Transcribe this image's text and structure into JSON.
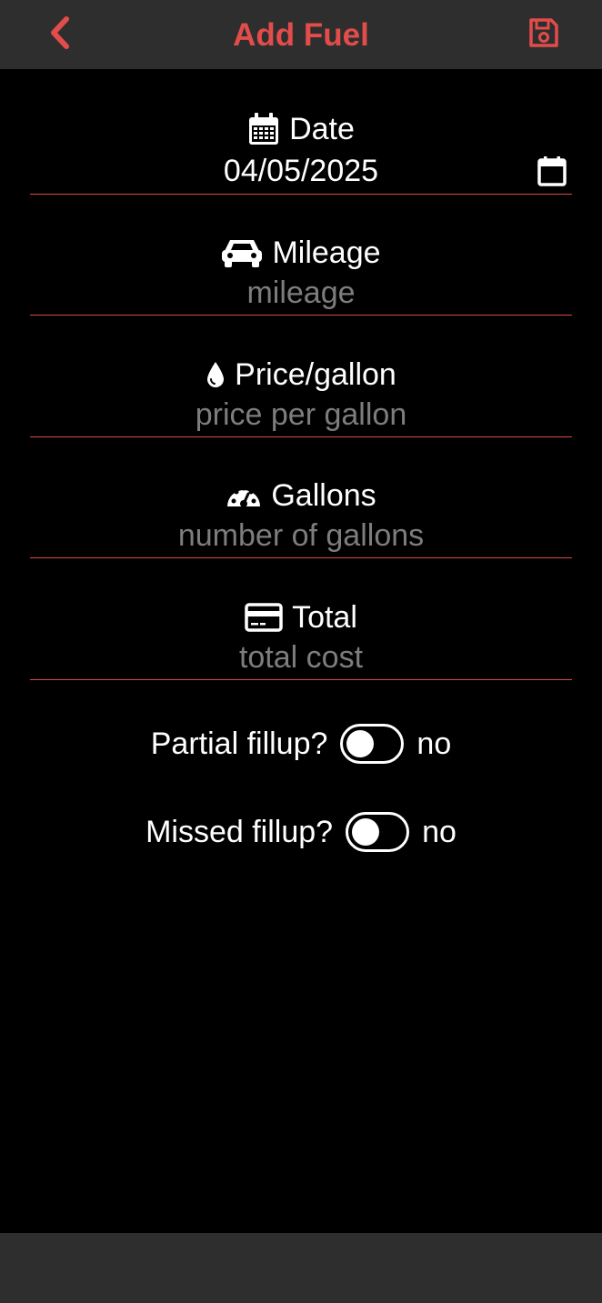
{
  "header": {
    "title": "Add Fuel",
    "back_icon": "chevron-left-icon",
    "save_icon": "floppy-disk-icon"
  },
  "fields": {
    "date": {
      "label": "Date",
      "value": "04/05/2025",
      "icon": "calendar-icon"
    },
    "mileage": {
      "label": "Mileage",
      "placeholder": "mileage",
      "icon": "car-icon"
    },
    "price": {
      "label": "Price/gallon",
      "placeholder": "price per gallon",
      "icon": "droplet-icon"
    },
    "gallons": {
      "label": "Gallons",
      "placeholder": "number of gallons",
      "icon": "gauge-icon"
    },
    "total": {
      "label": "Total",
      "placeholder": "total cost",
      "icon": "credit-card-icon"
    }
  },
  "toggles": {
    "partial": {
      "label": "Partial fillup?",
      "state": "no"
    },
    "missed": {
      "label": "Missed fillup?",
      "state": "no"
    }
  },
  "colors": {
    "accent": "#e24c4b",
    "bar_bg": "#2e2e2e",
    "background": "#000000",
    "placeholder": "#7d7d7d"
  }
}
